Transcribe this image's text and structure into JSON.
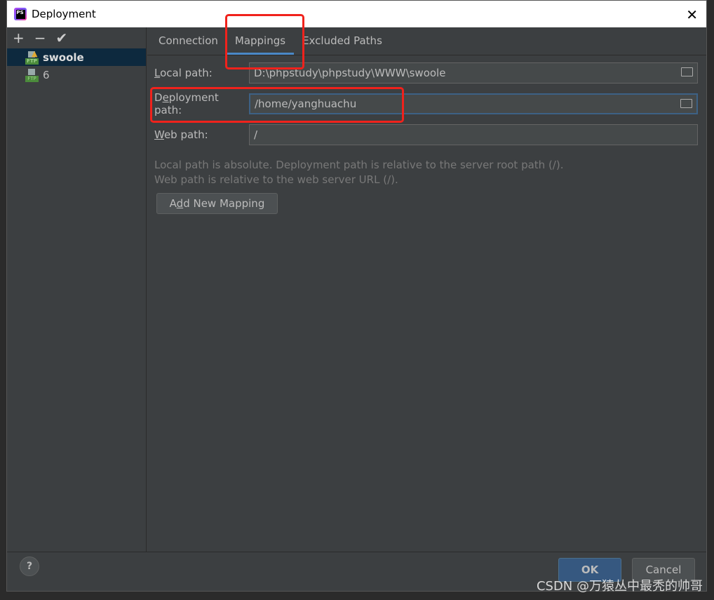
{
  "window": {
    "title": "Deployment",
    "close": "✕"
  },
  "toolbar": {
    "add": "+",
    "remove": "−",
    "apply": "✔"
  },
  "servers": [
    {
      "name": "swoole",
      "type": "FTP",
      "warning": true
    },
    {
      "name": "6",
      "type": "FTP",
      "warning": false
    }
  ],
  "tabs": [
    {
      "label": "Connection"
    },
    {
      "label": "Mappings",
      "active": true
    },
    {
      "label": "Excluded Paths"
    }
  ],
  "form": {
    "local": {
      "mn": "L",
      "rest": "ocal path:",
      "value": "D:\\phpstudy\\phpstudy\\WWW\\swoole"
    },
    "deploy": {
      "pre": "D",
      "mn": "e",
      "rest": "ployment path:",
      "value": "/home/yanghuachu"
    },
    "web": {
      "mn": "W",
      "rest": "eb path:",
      "value": "/"
    }
  },
  "hint": {
    "line1": "Local path is absolute. Deployment path is relative to the server root path (/).",
    "line2": "Web path is relative to the web server URL (/)."
  },
  "add_mapping": {
    "pre": "A",
    "mn": "d",
    "rest": "d New Mapping"
  },
  "footer": {
    "help": "?",
    "ok": "OK",
    "cancel": "Cancel"
  },
  "watermark": "CSDN @万猿丛中最秃的帅哥",
  "colors": {
    "accent": "#4a88c7",
    "highlight": "#f0221c",
    "selection": "#0d293e"
  }
}
